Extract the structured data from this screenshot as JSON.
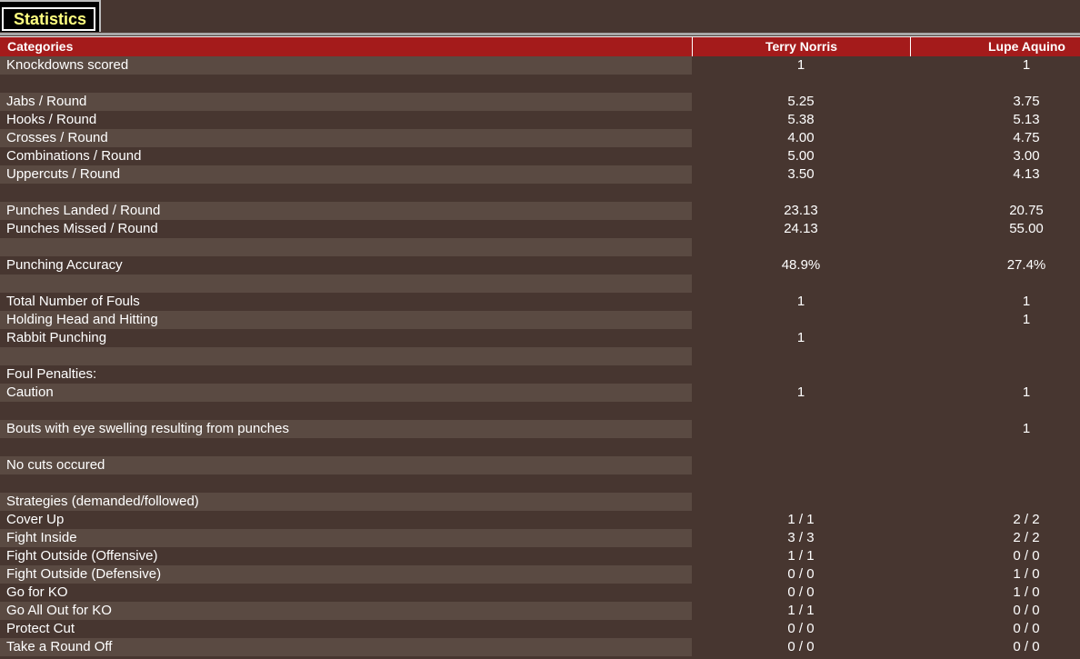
{
  "tab": {
    "label": "Statistics"
  },
  "header": {
    "categories": "Categories",
    "player1": "Terry Norris",
    "player2": "Lupe Aquino"
  },
  "rows": [
    {
      "label": "Knockdowns scored",
      "v1": "1",
      "v2": "1"
    },
    {
      "label": "",
      "v1": "",
      "v2": ""
    },
    {
      "label": "Jabs / Round",
      "v1": "5.25",
      "v2": "3.75"
    },
    {
      "label": "Hooks / Round",
      "v1": "5.38",
      "v2": "5.13"
    },
    {
      "label": "Crosses / Round",
      "v1": "4.00",
      "v2": "4.75"
    },
    {
      "label": "Combinations / Round",
      "v1": "5.00",
      "v2": "3.00"
    },
    {
      "label": "Uppercuts / Round",
      "v1": "3.50",
      "v2": "4.13"
    },
    {
      "label": "",
      "v1": "",
      "v2": ""
    },
    {
      "label": "Punches Landed / Round",
      "v1": "23.13",
      "v2": "20.75"
    },
    {
      "label": "Punches Missed / Round",
      "v1": "24.13",
      "v2": "55.00"
    },
    {
      "label": "",
      "v1": "",
      "v2": ""
    },
    {
      "label": "Punching Accuracy",
      "v1": "48.9%",
      "v2": "27.4%"
    },
    {
      "label": "",
      "v1": "",
      "v2": ""
    },
    {
      "label": "Total Number of Fouls",
      "v1": "1",
      "v2": "1"
    },
    {
      "label": "Holding Head and Hitting",
      "v1": "",
      "v2": "1"
    },
    {
      "label": "Rabbit Punching",
      "v1": "1",
      "v2": ""
    },
    {
      "label": "",
      "v1": "",
      "v2": ""
    },
    {
      "label": "Foul Penalties:",
      "v1": "",
      "v2": ""
    },
    {
      "label": "Caution",
      "v1": "1",
      "v2": "1"
    },
    {
      "label": "",
      "v1": "",
      "v2": ""
    },
    {
      "label": "Bouts with eye swelling resulting from punches",
      "v1": "",
      "v2": "1"
    },
    {
      "label": "",
      "v1": "",
      "v2": ""
    },
    {
      "label": "No cuts occured",
      "v1": "",
      "v2": ""
    },
    {
      "label": "",
      "v1": "",
      "v2": ""
    },
    {
      "label": "Strategies (demanded/followed)",
      "v1": "",
      "v2": ""
    },
    {
      "label": "Cover Up",
      "v1": "1 / 1",
      "v2": "2 / 2"
    },
    {
      "label": "Fight Inside",
      "v1": "3 / 3",
      "v2": "2 / 2"
    },
    {
      "label": "Fight Outside (Offensive)",
      "v1": "1 / 1",
      "v2": "0 / 0"
    },
    {
      "label": "Fight Outside (Defensive)",
      "v1": "0 / 0",
      "v2": "1 / 0"
    },
    {
      "label": "Go for KO",
      "v1": "0 / 0",
      "v2": "1 / 0"
    },
    {
      "label": "Go All Out for KO",
      "v1": "1 / 1",
      "v2": "0 / 0"
    },
    {
      "label": "Protect Cut",
      "v1": "0 / 0",
      "v2": "0 / 0"
    },
    {
      "label": "Take a Round Off",
      "v1": "0 / 0",
      "v2": "0 / 0"
    }
  ]
}
